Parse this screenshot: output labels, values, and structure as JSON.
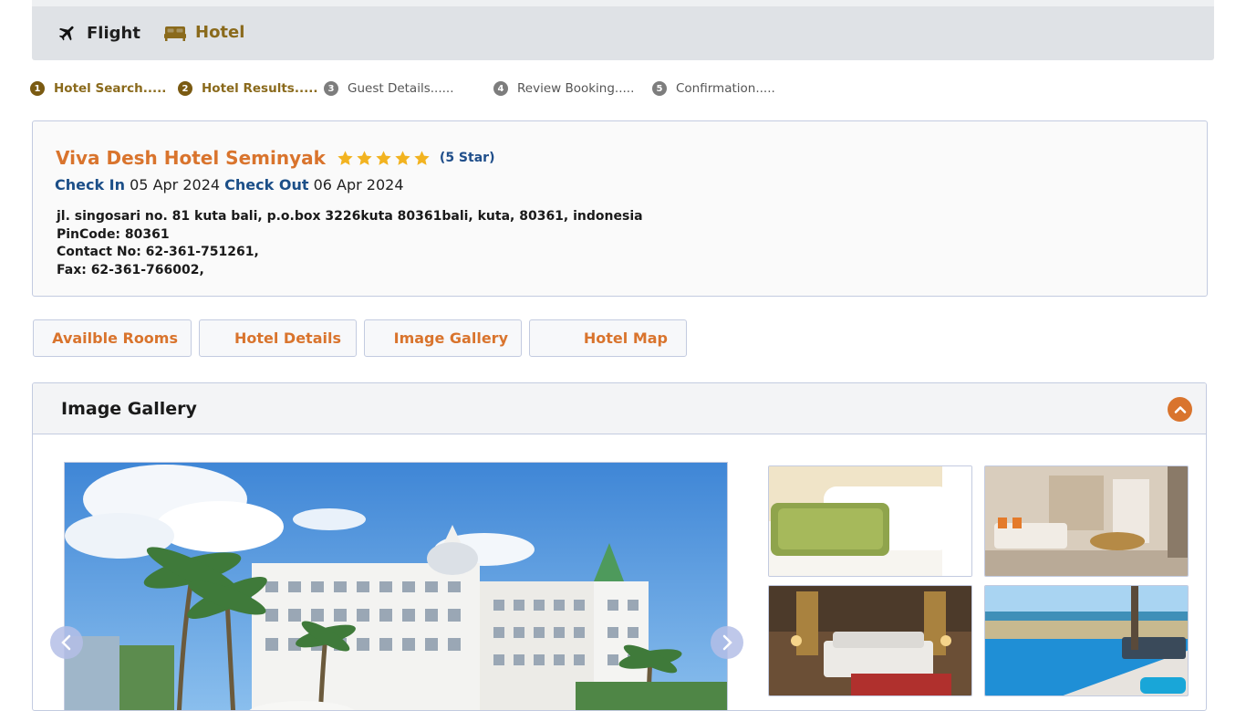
{
  "modes": {
    "flight": {
      "label": "Flight",
      "icon": "airplane-icon"
    },
    "hotel": {
      "label": "Hotel",
      "icon": "bed-icon"
    }
  },
  "steps": [
    {
      "num": "1",
      "label": "Hotel Search.....",
      "status": "done"
    },
    {
      "num": "2",
      "label": "Hotel Results.....",
      "status": "done"
    },
    {
      "num": "3",
      "label": "Guest Details......",
      "status": "todo"
    },
    {
      "num": "4",
      "label": "Review Booking.....",
      "status": "todo"
    },
    {
      "num": "5",
      "label": "Confirmation.....",
      "status": "todo"
    }
  ],
  "hotel": {
    "name": "Viva Desh Hotel Seminyak",
    "stars": 5,
    "star_label": "(5 Star)",
    "check_in_label": "Check In",
    "check_in": "05 Apr 2024",
    "check_out_label": "Check Out",
    "check_out": "06 Apr 2024",
    "address": "jl. singosari no. 81 kuta bali, p.o.box 3226kuta 80361bali, kuta, 80361, indonesia",
    "pincode": "PinCode: 80361",
    "contact": "Contact No: 62-361-751261,",
    "fax": "Fax: 62-361-766002,"
  },
  "tabs": {
    "rooms": "Availble Rooms",
    "details": "Hotel Details",
    "gallery": "Image Gallery",
    "map": "Hotel Map"
  },
  "gallery": {
    "title": "Image Gallery"
  },
  "colors": {
    "accent": "#d9742d",
    "brand_brown": "#8a6a1c",
    "link_blue": "#1c4f88",
    "border": "#c3cbe0"
  }
}
